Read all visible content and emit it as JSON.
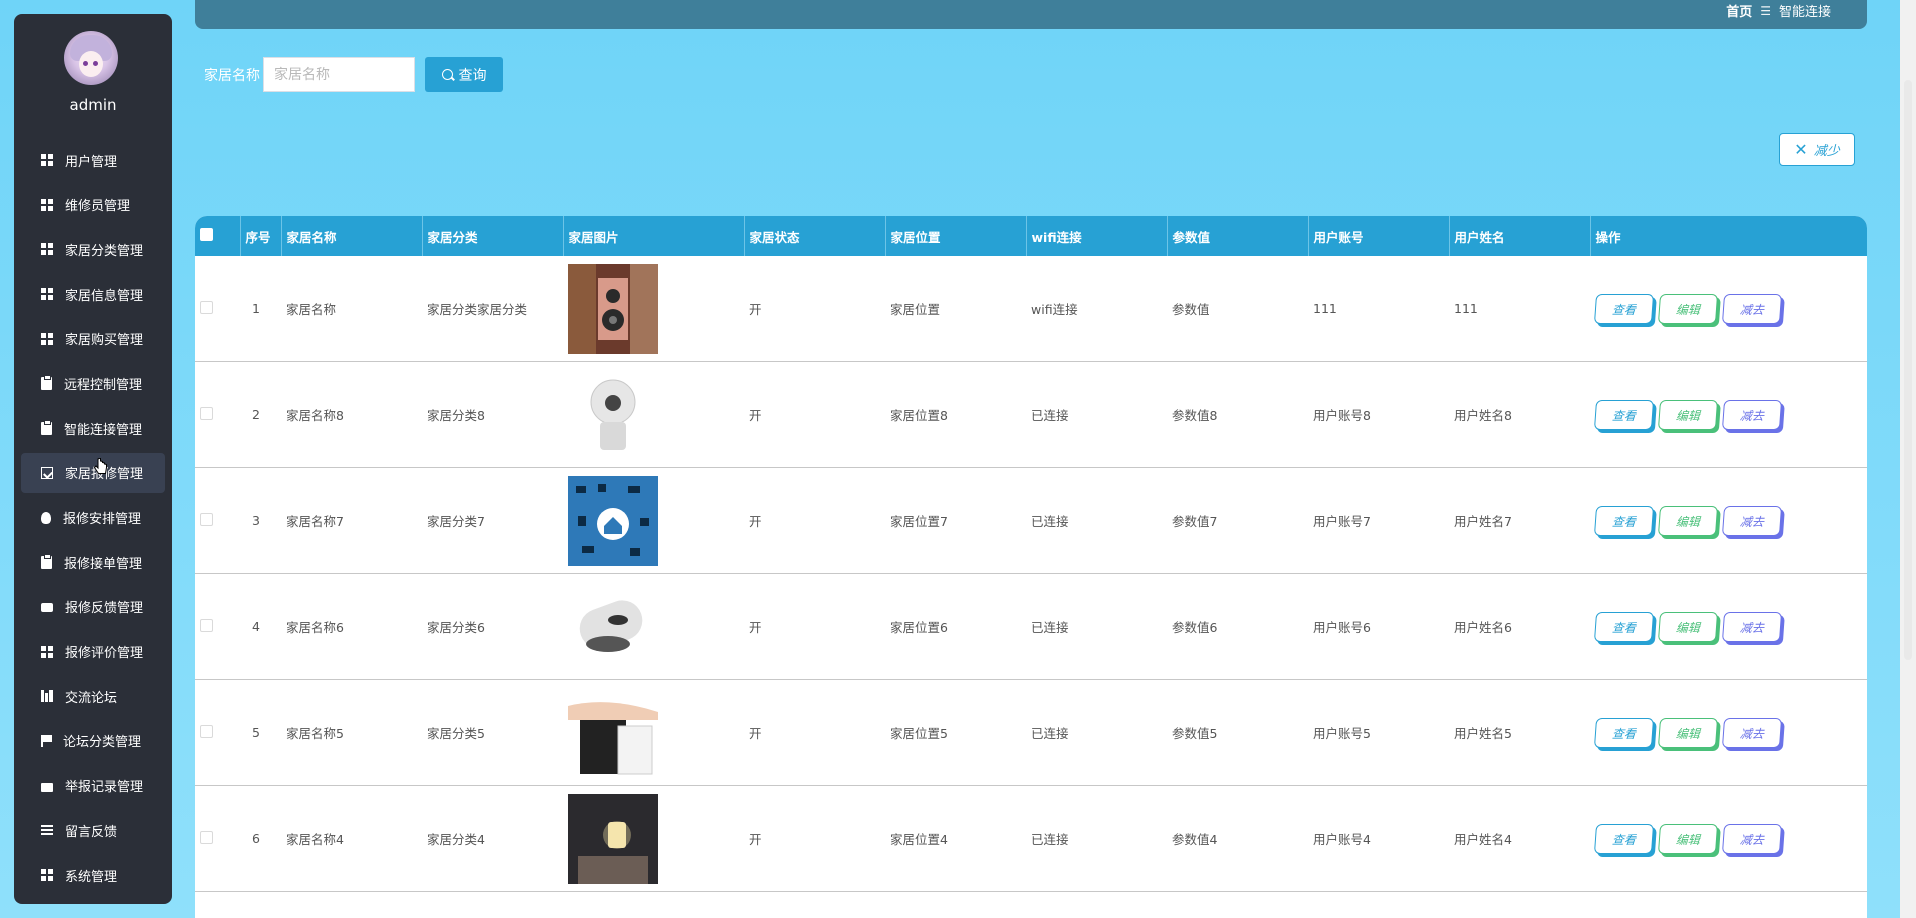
{
  "sidebar": {
    "username": "admin",
    "items": [
      {
        "label": "用户管理",
        "icon": "grid-icon"
      },
      {
        "label": "维修员管理",
        "icon": "grid-icon"
      },
      {
        "label": "家居分类管理",
        "icon": "grid-icon"
      },
      {
        "label": "家居信息管理",
        "icon": "grid-icon"
      },
      {
        "label": "家居购买管理",
        "icon": "grid-icon"
      },
      {
        "label": "远程控制管理",
        "icon": "clipboard-icon"
      },
      {
        "label": "智能连接管理",
        "icon": "clipboard-icon"
      },
      {
        "label": "家居报修管理",
        "icon": "chart-icon"
      },
      {
        "label": "报修安排管理",
        "icon": "bulb-icon"
      },
      {
        "label": "报修接单管理",
        "icon": "clipboard-icon"
      },
      {
        "label": "报修反馈管理",
        "icon": "printer-icon"
      },
      {
        "label": "报修评价管理",
        "icon": "grid-icon"
      },
      {
        "label": "交流论坛",
        "icon": "bars-icon"
      },
      {
        "label": "论坛分类管理",
        "icon": "flag-icon"
      },
      {
        "label": "举报记录管理",
        "icon": "briefcase-icon"
      },
      {
        "label": "留言反馈",
        "icon": "list-icon"
      },
      {
        "label": "系统管理",
        "icon": "grid-icon"
      }
    ],
    "active_index": 7
  },
  "breadcrumb": {
    "home": "首页",
    "separator": "☰",
    "current": "智能连接"
  },
  "search": {
    "label": "家居名称",
    "placeholder": "家居名称",
    "value": "",
    "button": "查询"
  },
  "actions": {
    "reduce": "减少"
  },
  "table": {
    "headers": [
      "序号",
      "家居名称",
      "家居分类",
      "家居图片",
      "家居状态",
      "家居位置",
      "wifi连接",
      "参数值",
      "用户账号",
      "用户姓名",
      "操作"
    ],
    "rows": [
      {
        "no": "1",
        "name": "家居名称",
        "category": "家居分类家居分类",
        "image": "speaker-image",
        "status": "开",
        "location": "家居位置",
        "wifi": "wifi连接",
        "param": "参数值",
        "account": "111",
        "username": "111"
      },
      {
        "no": "2",
        "name": "家居名称8",
        "category": "家居分类8",
        "image": "camera-image",
        "status": "开",
        "location": "家居位置8",
        "wifi": "已连接",
        "param": "参数值8",
        "account": "用户账号8",
        "username": "用户姓名8"
      },
      {
        "no": "3",
        "name": "家居名称7",
        "category": "家居分类7",
        "image": "smart-home-image",
        "status": "开",
        "location": "家居位置7",
        "wifi": "已连接",
        "param": "参数值7",
        "account": "用户账号7",
        "username": "用户姓名7"
      },
      {
        "no": "4",
        "name": "家居名称6",
        "category": "家居分类6",
        "image": "window-robot-image",
        "status": "开",
        "location": "家居位置6",
        "wifi": "已连接",
        "param": "参数值6",
        "account": "用户账号6",
        "username": "用户姓名6"
      },
      {
        "no": "5",
        "name": "家居名称5",
        "category": "家居分类5",
        "image": "projector-image",
        "status": "开",
        "location": "家居位置5",
        "wifi": "已连接",
        "param": "参数值5",
        "account": "用户账号5",
        "username": "用户姓名5"
      },
      {
        "no": "6",
        "name": "家居名称4",
        "category": "家居分类4",
        "image": "night-light-image",
        "status": "开",
        "location": "家居位置4",
        "wifi": "已连接",
        "param": "参数值4",
        "account": "用户账号4",
        "username": "用户姓名4"
      }
    ],
    "row_actions": {
      "view": "查看",
      "edit": "编辑",
      "delete": "减去"
    }
  },
  "colors": {
    "accent": "#27a1d4",
    "sidebar_bg": "#2b2f38",
    "edit": "#4ac07a",
    "delete": "#6a72e8",
    "topbar": "#3f7f9a"
  }
}
